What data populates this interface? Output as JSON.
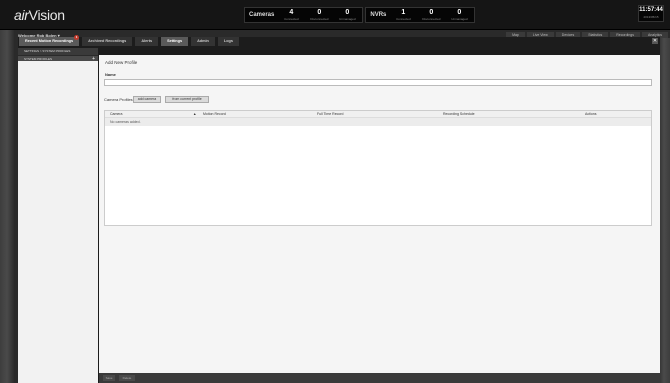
{
  "app": {
    "logo_prefix": "air",
    "logo_suffix": "Vision"
  },
  "stats": {
    "cameras": {
      "title": "Cameras",
      "items": [
        {
          "num": "4",
          "label": "Connected"
        },
        {
          "num": "0",
          "label": "Disconnected"
        },
        {
          "num": "0",
          "label": "Unmanaged"
        }
      ]
    },
    "nvrs": {
      "title": "NVRs",
      "items": [
        {
          "num": "1",
          "label": "Connected"
        },
        {
          "num": "0",
          "label": "Disconnected"
        },
        {
          "num": "0",
          "label": "Unmanaged"
        }
      ]
    }
  },
  "clock": {
    "time": "11:57:44",
    "date": "2013/05/15"
  },
  "main_tabs": [
    "Map",
    "Live View",
    "Devices",
    "Statistics",
    "Recordings",
    "Analytics"
  ],
  "welcome": "Welcome Rob Bolen",
  "dialog_tabs": [
    {
      "label": "Recent Motion Recordings",
      "badge": "1"
    },
    {
      "label": "Archived Recordings"
    },
    {
      "label": "Alerts"
    },
    {
      "label": "Settings"
    },
    {
      "label": "Admin"
    },
    {
      "label": "Logs"
    }
  ],
  "nav": {
    "breadcrumb": "SETTINGS > SYSTEM PROFILES",
    "item": "SYSTEM PROFILES",
    "plus": "+"
  },
  "form": {
    "title": "Add New Profile",
    "name_label": "Name",
    "name_value": "",
    "camera_profiles_label": "Camera Profiles",
    "add_camera": "add camera",
    "from_current": "from current profile"
  },
  "table": {
    "headers": [
      "Camera",
      "Motion Record",
      "Full Time Record",
      "Recording Schedule",
      "Actions"
    ],
    "empty": "No cameras added."
  },
  "footer": {
    "save": "Save",
    "delete": "Delete"
  }
}
